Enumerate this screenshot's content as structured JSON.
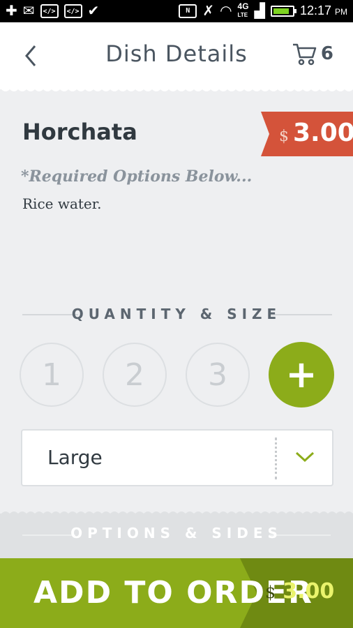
{
  "status_bar": {
    "time": "12:17",
    "ampm": "PM",
    "network": "4G",
    "network_sub": "LTE"
  },
  "header": {
    "title": "Dish Details",
    "cart_count": "6"
  },
  "dish": {
    "name": "Horchata",
    "price_symbol": "$",
    "price": "3.00",
    "required_note": "*Required Options Below...",
    "description": "Rice water."
  },
  "quantity": {
    "section_label": "QUANTITY & SIZE",
    "options": [
      "1",
      "2",
      "3"
    ],
    "plus_label": "+"
  },
  "size": {
    "selected": "Large"
  },
  "options_section": {
    "label": "OPTIONS & SIDES"
  },
  "footer": {
    "add_label": "ADD TO ORDER",
    "price_symbol": "$",
    "price": "3.00"
  },
  "colors": {
    "accent_green": "#8cac1a",
    "dark_green": "#6f8a12",
    "price_tag": "#d4533a",
    "price_yellow": "#eaf36c"
  }
}
